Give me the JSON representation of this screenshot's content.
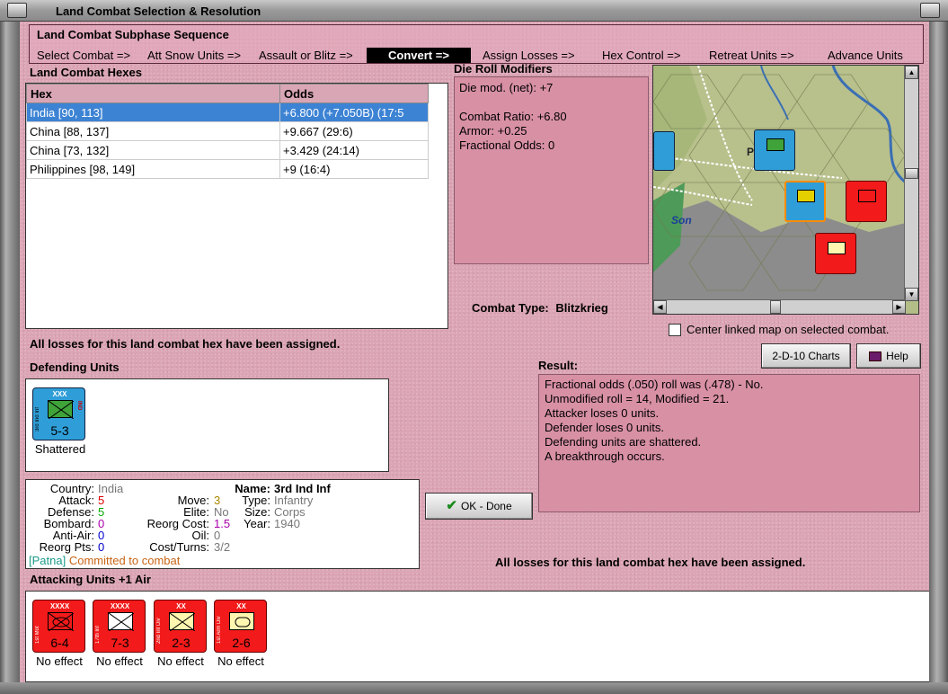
{
  "window": {
    "title": "Land Combat Selection & Resolution"
  },
  "subphase": {
    "title": "Land Combat Subphase Sequence",
    "steps": [
      "Select Combat =>",
      "Att Snow Units =>",
      "Assault or Blitz =>",
      "Convert =>",
      "Assign Losses =>",
      "Hex Control =>",
      "Retreat Units =>",
      "Advance Units"
    ],
    "active_index": 3
  },
  "hexes": {
    "title": "Land Combat Hexes",
    "columns": [
      "Hex",
      "Odds"
    ],
    "rows": [
      {
        "hex": "India [90, 113]",
        "odds": "+6.800 (+7.050B) (17:5"
      },
      {
        "hex": "China [88, 137]",
        "odds": "+9.667 (29:6)"
      },
      {
        "hex": "China [73, 132]",
        "odds": "+3.429 (24:14)"
      },
      {
        "hex": "Philippines [98, 149]",
        "odds": "+9 (16:4)"
      }
    ],
    "selected_index": 0
  },
  "die_roll": {
    "title": "Die Roll Modifiers",
    "lines": [
      "Die mod. (net): +7",
      "",
      "Combat Ratio: +6.80",
      "Armor: +0.25",
      "Fractional Odds: 0"
    ]
  },
  "combat_type": {
    "label": "Combat Type:",
    "value": "Blitzkrieg"
  },
  "map": {
    "label_p": "P",
    "label_son": "Son",
    "center_checkbox_label": "Center linked map on selected combat.",
    "center_checked": false
  },
  "losses_msg_top": "All losses for this land combat hex have been assigned.",
  "losses_msg_bottom": "All losses for this land combat hex have been assigned.",
  "buttons": {
    "charts": "2-D-10 Charts",
    "help": "Help",
    "ok": "OK - Done"
  },
  "result": {
    "title": "Result:",
    "lines": [
      "Fractional odds (.050) roll was (.478)  - No.",
      "Unmodified roll = 14, Modified = 21.",
      "Attacker loses 0 units.",
      "Defender loses 0 units.",
      "Defending units are shattered.",
      "A breakthrough occurs."
    ]
  },
  "defending": {
    "title": "Defending Units",
    "units": [
      {
        "size": "XXX",
        "side_label": "3rd Ind Inf",
        "strength": "5-3",
        "nat": "IND",
        "status": "Shattered"
      }
    ]
  },
  "unit_info": {
    "country_label": "Country:",
    "country": "India",
    "attack_label": "Attack:",
    "attack": "5",
    "defense_label": "Defense:",
    "defense": "5",
    "bombard_label": "Bombard:",
    "bombard": "0",
    "antiair_label": "Anti-Air:",
    "antiair": "0",
    "reorgpts_label": "Reorg Pts:",
    "reorgpts": "0",
    "move_label": "Move:",
    "move": "3",
    "elite_label": "Elite:",
    "elite": "No",
    "reorgcost_label": "Reorg Cost:",
    "reorgcost": "1.5",
    "oil_label": "Oil:",
    "oil": "0",
    "costturns_label": "Cost/Turns:",
    "costturns": "3/2",
    "name_label": "Name:",
    "name": "3rd Ind Inf",
    "type_label": "Type:",
    "type": "Infantry",
    "unitsize_label": "Size:",
    "unitsize": "Corps",
    "year_label": "Year:",
    "year": "1940",
    "location": "[Patna]",
    "committed": "Committed to combat"
  },
  "attacking": {
    "title": "Attacking Units +1 Air",
    "units": [
      {
        "size": "XXXX",
        "side_label": "1st Mot",
        "strength": "6-4",
        "effect": "No effect",
        "symbol": "mech"
      },
      {
        "size": "XXXX",
        "side_label": "17th Inf",
        "strength": "7-3",
        "effect": "No effect",
        "symbol": "inf"
      },
      {
        "size": "XX",
        "side_label": "2nd Inf Div",
        "strength": "2-3",
        "effect": "No effect",
        "symbol": "inf-yellow"
      },
      {
        "size": "XX",
        "side_label": "1st Arm Div",
        "strength": "2-6",
        "effect": "No effect",
        "symbol": "armor"
      }
    ]
  },
  "colors": {
    "panel_pink": "#dba5b5",
    "result_pink": "#d890a5",
    "selected_row": "#3d83d4",
    "unit_red": "#f21a1a",
    "unit_blue": "#2f9ed8"
  }
}
